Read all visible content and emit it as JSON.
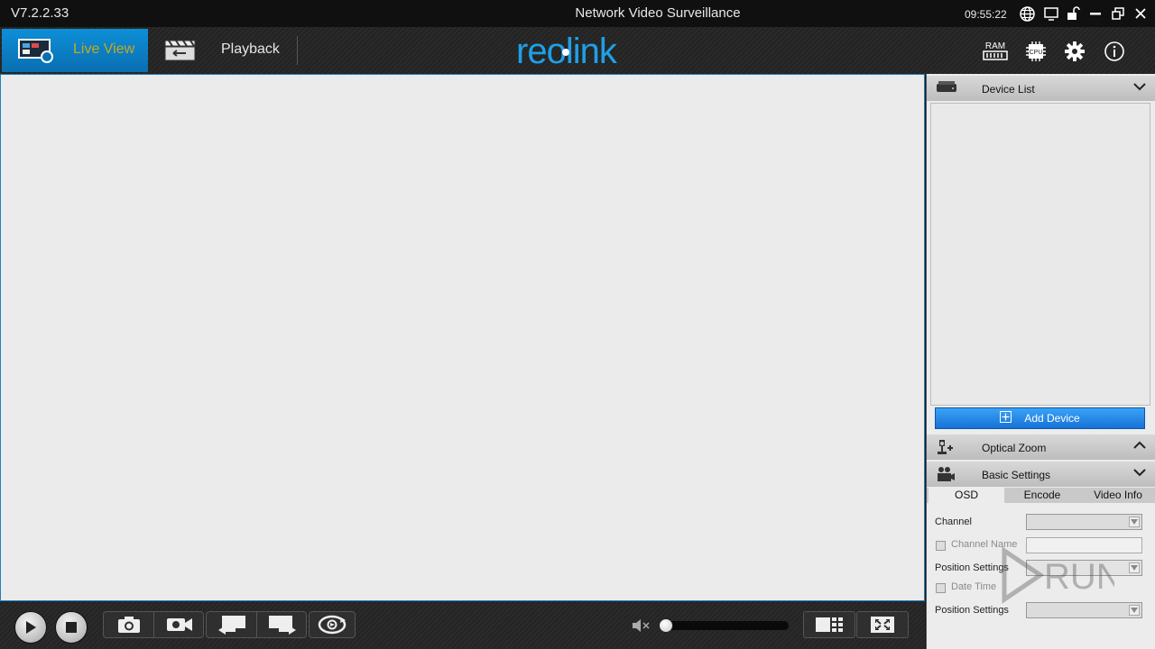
{
  "titlebar": {
    "version": "V7.2.2.33",
    "title": "Network Video Surveillance",
    "time": "09:55:22",
    "icons": [
      "globe-icon",
      "monitor-icon",
      "lock-icon",
      "minimize-icon",
      "restore-icon",
      "close-icon"
    ]
  },
  "nav": {
    "tabs": [
      {
        "label": "Live View",
        "active": true
      },
      {
        "label": "Playback",
        "active": false
      }
    ],
    "logo": "reolink",
    "right_icons": [
      {
        "label": "RAM"
      },
      {
        "label": "CPU"
      },
      {
        "icon": "gear-icon"
      },
      {
        "icon": "info-icon"
      }
    ]
  },
  "panel": {
    "device_list": {
      "title": "Device List"
    },
    "add_device": "Add Device",
    "optical_zoom": {
      "title": "Optical Zoom"
    },
    "basic_settings": {
      "title": "Basic Settings",
      "tabs": [
        "OSD",
        "Encode",
        "Video Info"
      ],
      "active_tab": "OSD",
      "fields": {
        "channel": "Channel",
        "channel_name": "Channel Name",
        "position_settings_1": "Position Settings",
        "date_time": "Date Time",
        "position_settings_2": "Position Settings"
      }
    }
  },
  "colors": {
    "accent": "#0d8fd8",
    "active_tab_text": "#c7a91c",
    "add_button": "#1e88ee"
  },
  "controls": {
    "buttons": [
      "play-icon",
      "stop-icon",
      "snapshot-icon",
      "record-icon",
      "previous-icon",
      "next-icon",
      "rotate-icon",
      "layout-icon",
      "fullscreen-icon"
    ],
    "volume_icon": "mute-icon"
  },
  "watermark": "RUN"
}
